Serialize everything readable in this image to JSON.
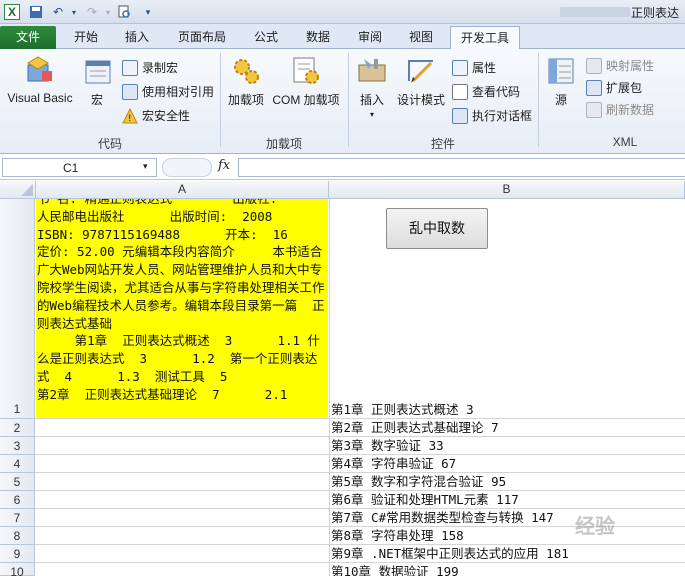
{
  "titlebar": {
    "title": "正则表达"
  },
  "tabs": [
    {
      "label": "文件"
    },
    {
      "label": "开始"
    },
    {
      "label": "插入"
    },
    {
      "label": "页面布局"
    },
    {
      "label": "公式"
    },
    {
      "label": "数据"
    },
    {
      "label": "审阅"
    },
    {
      "label": "视图"
    },
    {
      "label": "开发工具"
    }
  ],
  "ribbon": {
    "code": {
      "label": "代码",
      "visual_basic": "Visual Basic",
      "macros": "宏",
      "record_macro": "录制宏",
      "relative_ref": "使用相对引用",
      "macro_security": "宏安全性"
    },
    "addins": {
      "label": "加载项",
      "addins": "加载项",
      "com_addins": "COM 加载项"
    },
    "controls": {
      "label": "控件",
      "insert": "插入",
      "design_mode": "设计模式",
      "properties": "属性",
      "view_code": "查看代码",
      "run_dialog": "执行对话框"
    },
    "xml": {
      "label": "XML",
      "source": "源",
      "map_properties": "映射属性",
      "expansion_packs": "扩展包",
      "refresh_data": "刷新数据"
    }
  },
  "formula_bar": {
    "name_box": "C1",
    "fx": "fx",
    "formula": ""
  },
  "columns": [
    "A",
    "B"
  ],
  "rows": [
    "1",
    "2",
    "3",
    "4",
    "5",
    "6",
    "7",
    "8",
    "9",
    "10"
  ],
  "cell_a1": "书 名: 精通正则表达式        出版社:\n人民邮电出版社      出版时间:  2008\nISBN: 9787115169488      开本:  16\n定价: 52.00 元编辑本段内容简介     本书适合广大Web网站开发人员、网站管理维护人员和大中专院校学生阅读，尤其适合从事与字符串处理相关工作的Web编程技术人员参考。编辑本段目录第一篇  正则表达式基础\n     第1章  正则表达式概述  3      1.1 什么是正则表达式  3      1.2  第一个正则表达式  4      1.3  测试工具  5\n第2章  正则表达式基础理论  7      2.1",
  "button_shuffle": "乱中取数",
  "column_b": [
    "第1章  正则表达式概述  3",
    "第2章  正则表达式基础理论  7",
    "第3章  数字验证  33",
    "第4章  字符串验证  67",
    "第5章  数字和字符混合验证  95",
    "第6章  验证和处理HTML元素  117",
    "第7章  C#常用数据类型检查与转换  147",
    "第8章  字符串处理  158",
    "第9章  .NET框架中正则表达式的应用  181",
    "第10章 数据验证  199"
  ],
  "watermark": "经验"
}
